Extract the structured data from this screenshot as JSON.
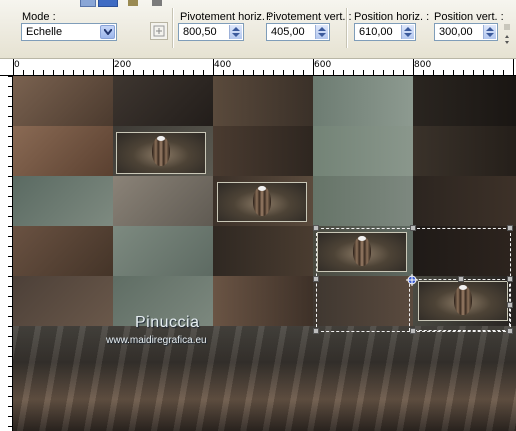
{
  "toolbar": {
    "mode_label": "Mode :",
    "mode_value": "Echelle",
    "pivot_h_label": "Pivotement horiz. :",
    "pivot_h_value": "800,50",
    "pivot_v_label": "Pivotement vert. :",
    "pivot_v_value": "405,00",
    "pos_h_label": "Position horiz. :",
    "pos_h_value": "610,00",
    "pos_v_label": "Position vert. :",
    "pos_v_value": "300,00"
  },
  "ruler": {
    "h_ticks": [
      "0",
      "200",
      "400",
      "600",
      "800"
    ]
  },
  "canvas": {
    "watermark": "Pinuccia",
    "watermark_url": "www.maidiregrafica.eu"
  },
  "colors": {
    "toolbar_bg": "#ece9d8",
    "input_border": "#7f9db9",
    "spin_arrow": "#3b5a9c"
  },
  "icons": [
    "chevron-down-icon",
    "pivot-point-icon",
    "spin-up-icon",
    "spin-down-icon"
  ]
}
